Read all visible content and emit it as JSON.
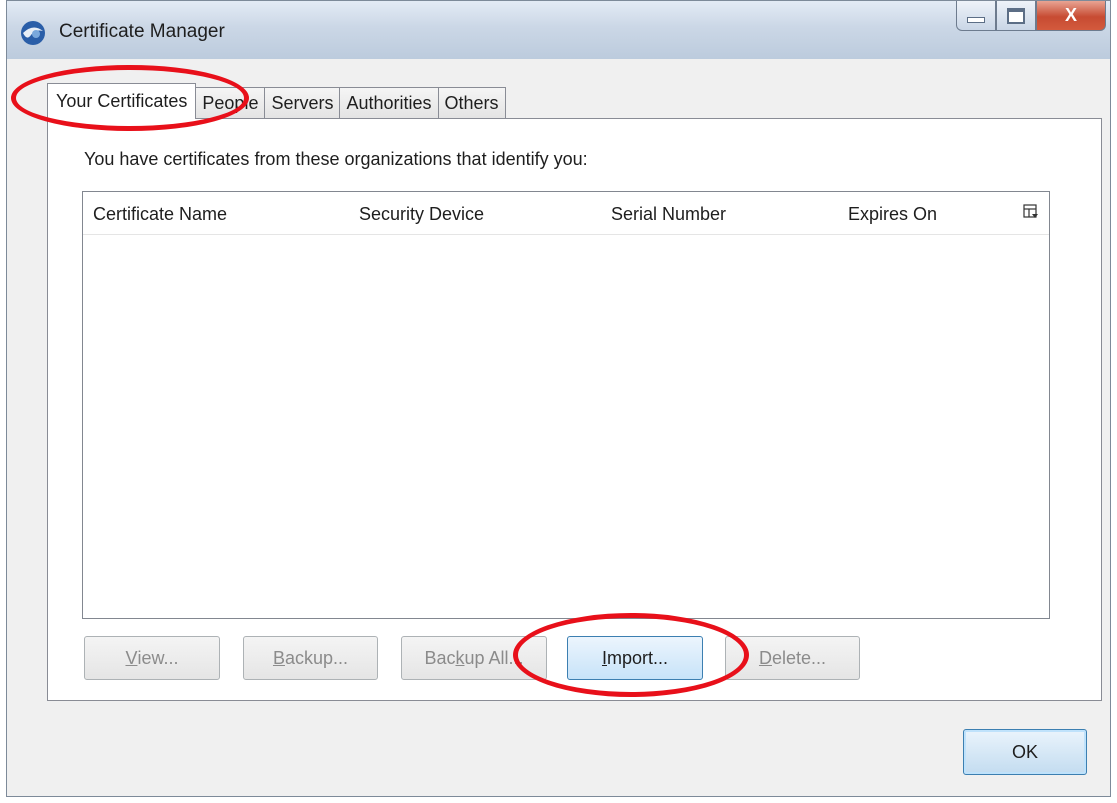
{
  "window": {
    "title": "Certificate Manager",
    "close_glyph": "X"
  },
  "tabs": [
    {
      "label": "Your Certificates",
      "active": true
    },
    {
      "label": "People",
      "active": false
    },
    {
      "label": "Servers",
      "active": false
    },
    {
      "label": "Authorities",
      "active": false
    },
    {
      "label": "Others",
      "active": false
    }
  ],
  "panel": {
    "intro": "You have certificates from these organizations that identify you:"
  },
  "table": {
    "columns": [
      "Certificate Name",
      "Security Device",
      "Serial Number",
      "Expires On"
    ],
    "rows": []
  },
  "buttons": {
    "view": {
      "pre": "",
      "key": "V",
      "post": "iew..."
    },
    "backup": {
      "pre": "",
      "key": "B",
      "post": "ackup..."
    },
    "backup_all": {
      "pre": "Bac",
      "key": "k",
      "post": "up All..."
    },
    "import": {
      "pre": "",
      "key": "I",
      "post": "mport..."
    },
    "delete": {
      "pre": "",
      "key": "D",
      "post": "elete..."
    },
    "ok": "OK"
  },
  "colors": {
    "annotation": "#e8101a",
    "accent_border": "#3c7fb1"
  },
  "icons": {
    "app": "thunderbird-icon",
    "column_picker": "column-picker-icon"
  }
}
